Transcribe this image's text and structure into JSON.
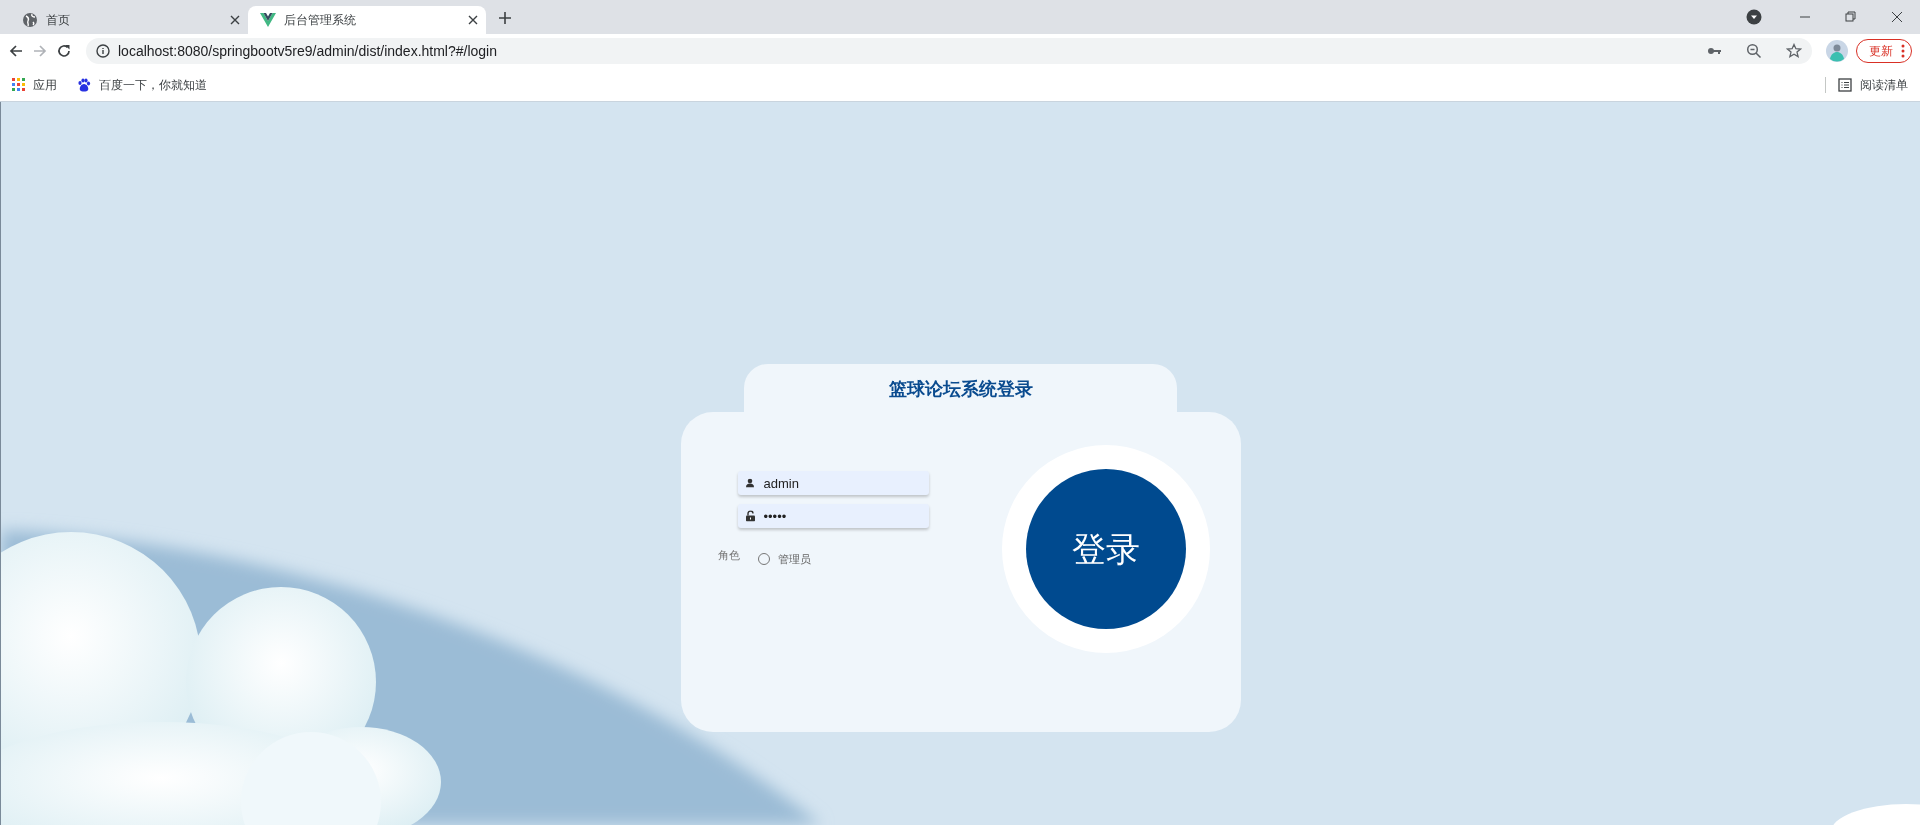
{
  "browser": {
    "tabs": [
      {
        "title": "首页",
        "kind": "globe",
        "selected": false
      },
      {
        "title": "后台管理系统",
        "kind": "vue",
        "selected": true
      }
    ],
    "address": "localhost:8080/springbootv5re9/admin/dist/index.html?#/login",
    "back_disabled": false,
    "forward_disabled": true,
    "update_button": "更新",
    "bookmarks": [
      {
        "label": "应用",
        "kind": "apps"
      },
      {
        "label": "百度一下，你就知道",
        "kind": "paw"
      }
    ],
    "reading_list": "阅读清单"
  },
  "login": {
    "title": "篮球论坛系统登录",
    "fields": [
      {
        "kind": "user",
        "value": "admin"
      },
      {
        "kind": "lock",
        "value": "•••••"
      }
    ],
    "role_label": "角色",
    "roles": [
      {
        "label": "管理员",
        "selected": false
      }
    ],
    "submit": "登录"
  }
}
